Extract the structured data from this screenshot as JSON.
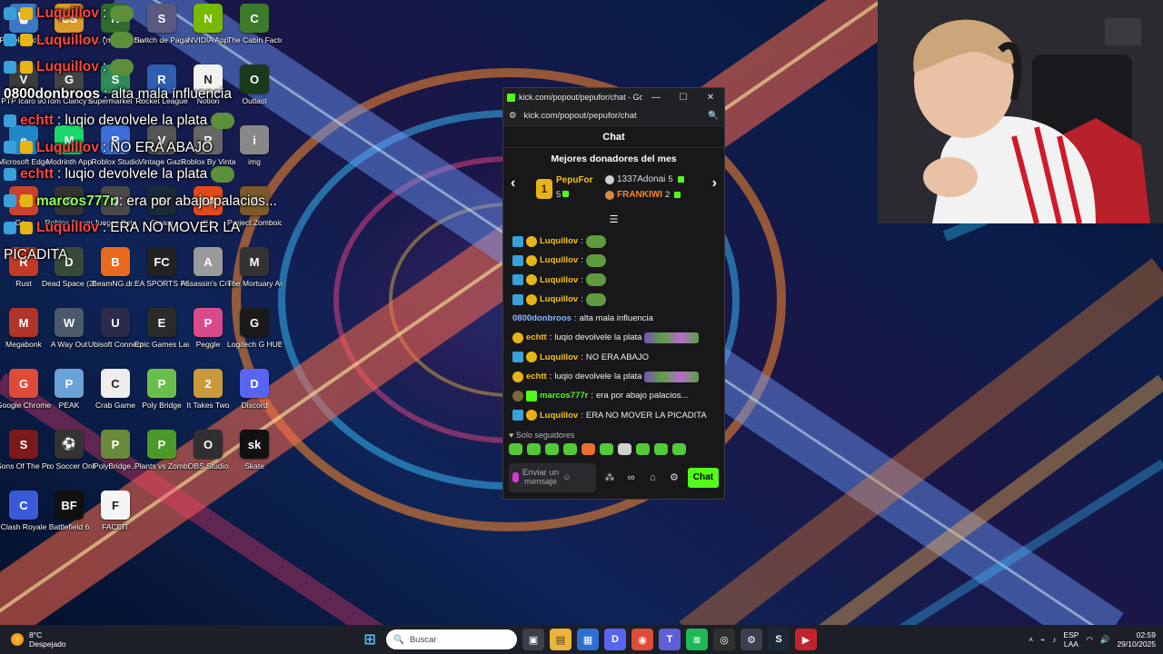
{
  "desktop_icons": [
    {
      "label": "Papelera de...",
      "color": "#3a78c2",
      "glyph": "🗑"
    },
    {
      "label": "Counter-Strike",
      "color": "#d99b2b",
      "glyph": "CS"
    },
    {
      "label": "No, I'm not a Hum...",
      "color": "#2f6b2f",
      "glyph": "N"
    },
    {
      "label": "Switch de Pagas",
      "color": "#5a5a80",
      "glyph": "S"
    },
    {
      "label": "NVIDIA App",
      "color": "#76b900",
      "glyph": "N"
    },
    {
      "label": "The Cabin Factory",
      "color": "#3d7a2a",
      "glyph": "C"
    },
    {
      "label": "PTP Icaro 90",
      "color": "#3b3b3b",
      "glyph": "V"
    },
    {
      "label": "Tom Clancy's",
      "color": "#444",
      "glyph": "G"
    },
    {
      "label": "Supermarket Together",
      "color": "#2e8b57",
      "glyph": "S"
    },
    {
      "label": "Rocket League",
      "color": "#2f5fb0",
      "glyph": "R"
    },
    {
      "label": "Notion",
      "color": "#f2f2f2",
      "glyph": "N"
    },
    {
      "label": "Outlast",
      "color": "#1a3a1a",
      "glyph": "O"
    },
    {
      "label": "Microsoft Edge",
      "color": "#1e88c8",
      "glyph": "e"
    },
    {
      "label": "Modrinth App",
      "color": "#1bd96a",
      "glyph": "M"
    },
    {
      "label": "Roblox Studio",
      "color": "#3a6ed8",
      "glyph": "R"
    },
    {
      "label": "Vintage Gaze",
      "color": "#555",
      "glyph": "V"
    },
    {
      "label": "Roblox By Vintage Gau",
      "color": "#666",
      "glyph": "R"
    },
    {
      "label": "img",
      "color": "#888",
      "glyph": "i"
    },
    {
      "label": "Go...",
      "color": "#c9412c",
      "glyph": "G"
    },
    {
      "label": "Roblox Player",
      "color": "#333",
      "glyph": "R"
    },
    {
      "label": "Juegos Beta",
      "color": "#4a4a4a",
      "glyph": "J"
    },
    {
      "label": "Steam",
      "color": "#1b2838",
      "glyph": "S"
    },
    {
      "label": "EA",
      "color": "#e24a1a",
      "glyph": "EA"
    },
    {
      "label": "Project Zomboid",
      "color": "#7a5a2a",
      "glyph": "Z"
    },
    {
      "label": "Rust",
      "color": "#c13a24",
      "glyph": "R"
    },
    {
      "label": "Dead Space (2023)",
      "color": "#3a4a3a",
      "glyph": "D"
    },
    {
      "label": "BeamNG.dr...",
      "color": "#e86a1c",
      "glyph": "B"
    },
    {
      "label": "EA SPORTS FC 26",
      "color": "#222",
      "glyph": "FC"
    },
    {
      "label": "Assassin's Creed I",
      "color": "#9a9a9a",
      "glyph": "A"
    },
    {
      "label": "The Mortuary Assistant",
      "color": "#333",
      "glyph": "M"
    },
    {
      "label": "Megabonk",
      "color": "#b0342a",
      "glyph": "M"
    },
    {
      "label": "A Way Out",
      "color": "#4a5a6a",
      "glyph": "W"
    },
    {
      "label": "Ubisoft Connect",
      "color": "#2a2a4a",
      "glyph": "U"
    },
    {
      "label": "Epic Games Launcher",
      "color": "#2a2a2a",
      "glyph": "E"
    },
    {
      "label": "Peggle",
      "color": "#d84a8a",
      "glyph": "P"
    },
    {
      "label": "Logitech G HUB",
      "color": "#1a1a1a",
      "glyph": "G"
    },
    {
      "label": "Google Chrome",
      "color": "#dd4b39",
      "glyph": "G"
    },
    {
      "label": "PEAK",
      "color": "#6aa3d8",
      "glyph": "P"
    },
    {
      "label": "Crab Game",
      "color": "#eee",
      "glyph": "C"
    },
    {
      "label": "Poly Bridge",
      "color": "#6abf4a",
      "glyph": "P"
    },
    {
      "label": "It Takes Two",
      "color": "#c89a3a",
      "glyph": "2"
    },
    {
      "label": "Discord",
      "color": "#5865f2",
      "glyph": "D"
    },
    {
      "label": "Sons Of The Forest",
      "color": "#7a1a1a",
      "glyph": "S"
    },
    {
      "label": "Pro Soccer Online",
      "color": "#333",
      "glyph": "⚽"
    },
    {
      "label": "PolyBridge...",
      "color": "#6a8a3a",
      "glyph": "P"
    },
    {
      "label": "Plants vs Zombies Re...",
      "color": "#4a9a2a",
      "glyph": "P"
    },
    {
      "label": "OBS Studio",
      "color": "#302e31",
      "glyph": "O"
    },
    {
      "label": "Skate",
      "color": "#111",
      "glyph": "sk"
    },
    {
      "label": "Clash Royale",
      "color": "#3a5ad8",
      "glyph": "C"
    },
    {
      "label": "Battlefield 6",
      "color": "#111",
      "glyph": "BF"
    },
    {
      "label": "FACEIT",
      "color": "#f5f5f5",
      "glyph": "F"
    }
  ],
  "overlay_chat": [
    {
      "user": "Luquillov",
      "text": "",
      "color": "#ff4444",
      "badges": 2,
      "emote": true
    },
    {
      "user": "Luquillov",
      "text": "",
      "color": "#ff4444",
      "badges": 2,
      "emote": true
    },
    {
      "user": "Luquillov",
      "text": "",
      "color": "#ff4444",
      "badges": 2,
      "emote": true
    },
    {
      "user": "0800donbroos",
      "text": "alta mala influencia",
      "color": "#ffffff",
      "badges": 0,
      "emote": false
    },
    {
      "user": "echtt",
      "text": "luqio devolvele la plata",
      "color": "#ff4444",
      "badges": 1,
      "emote": true
    },
    {
      "user": "Luquillov",
      "text": "NO ERA ABAJO",
      "color": "#ff4444",
      "badges": 2,
      "emote": false
    },
    {
      "user": "echtt",
      "text": "luqio devolvele la plata",
      "color": "#ff4444",
      "badges": 1,
      "emote": true
    },
    {
      "user": "marcos777r",
      "text": "era por abajo palacios...",
      "color": "#8fff5a",
      "badges": 2,
      "emote": false
    },
    {
      "user": "Luquillov",
      "text": "ERA NO MOVER LA",
      "color": "#ff4444",
      "badges": 2,
      "emote": false
    },
    {
      "user": "",
      "text": "PICADITA",
      "color": "#ffffff",
      "badges": 0,
      "emote": false
    }
  ],
  "chat_window": {
    "title": "kick.com/popout/pepufor/chat - Go...",
    "url": "kick.com/popout/pepufor/chat",
    "header": "Chat",
    "donors_title": "Mejores donadores del mes",
    "donors": [
      {
        "rank": "1",
        "name": "PepuFor",
        "amount": "5"
      },
      {
        "rank": "2",
        "name": "1337Adonai",
        "amount": "5"
      },
      {
        "rank": "3",
        "name": "FRANKIWI",
        "amount": "2"
      }
    ],
    "messages": [
      {
        "user": "Luquillov",
        "text": "",
        "color": "#f4c10f",
        "badges": [
          "star",
          "gold"
        ],
        "emote": "pepe"
      },
      {
        "user": "Luquillov",
        "text": "",
        "color": "#f4c10f",
        "badges": [
          "star",
          "gold"
        ],
        "emote": "pepe"
      },
      {
        "user": "Luquillov",
        "text": "",
        "color": "#f4c10f",
        "badges": [
          "star",
          "gold"
        ],
        "emote": "pepe"
      },
      {
        "user": "Luquillov",
        "text": "",
        "color": "#f4c10f",
        "badges": [
          "star",
          "gold"
        ],
        "emote": "pepe"
      },
      {
        "user": "0800donbroos",
        "text": "alta mala influencia",
        "color": "#8ab4ff",
        "badges": [],
        "emote": ""
      },
      {
        "user": "echtt",
        "text": "luqio devolvele la plata",
        "color": "#f4c10f",
        "badges": [
          "gold"
        ],
        "emote": "wide"
      },
      {
        "user": "Luquillov",
        "text": "NO ERA ABAJO",
        "color": "#f4c10f",
        "badges": [
          "star",
          "gold"
        ],
        "emote": ""
      },
      {
        "user": "echtt",
        "text": "luqio devolvele la plata",
        "color": "#f4c10f",
        "badges": [
          "gold"
        ],
        "emote": "wide"
      },
      {
        "user": "marcos777r",
        "text": "era por abajo palacios...",
        "color": "#53fc18",
        "badges": [
          "gray",
          "sub"
        ],
        "emote": ""
      },
      {
        "user": "Luquillov",
        "text": "ERA NO MOVER LA PICADITA",
        "color": "#f4c10f",
        "badges": [
          "star",
          "gold"
        ],
        "emote": ""
      }
    ],
    "followers_label": "Solo seguidores",
    "input_placeholder": "Enviar un mensaje",
    "send_label": "Chat"
  },
  "taskbar": {
    "temperature": "8°C",
    "weather": "Despejado",
    "search_placeholder": "Buscar",
    "language_top": "ESP",
    "language_bottom": "LAA",
    "time": "02:59",
    "date": "29/10/2025"
  },
  "colors": {
    "kick_green": "#53fc18",
    "chat_bg": "#18181b",
    "gold": "#f4c10f"
  }
}
